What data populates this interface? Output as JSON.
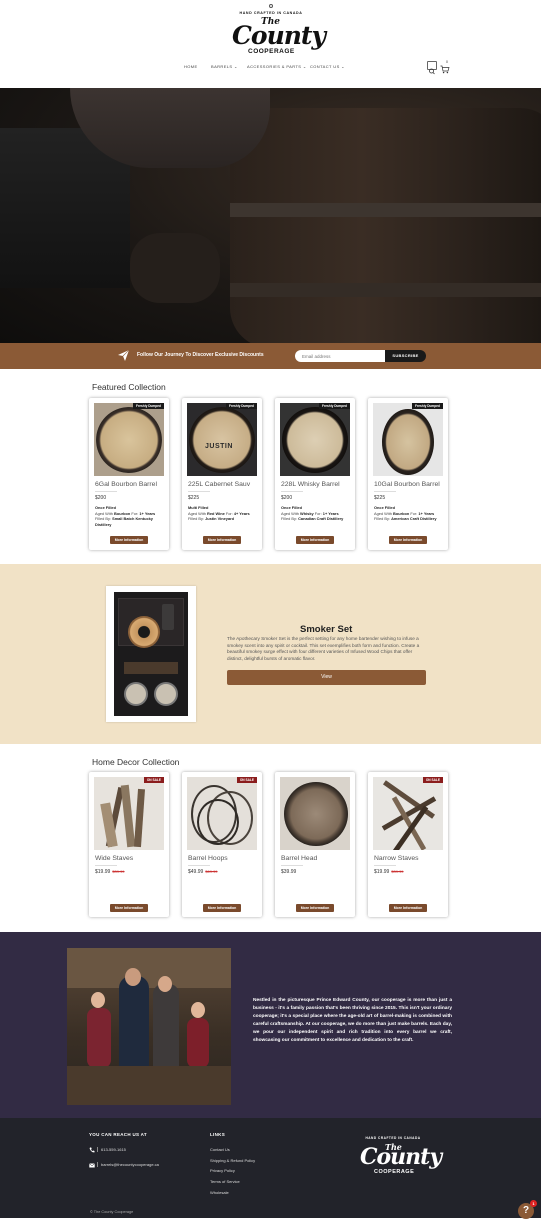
{
  "header": {
    "logo_arc": "HAND CRAFTED IN CANADA",
    "logo_the": "The",
    "logo_county": "County",
    "logo_cooperage": "COOPERAGE",
    "nav": [
      {
        "label": "HOME"
      },
      {
        "label": "BARRELS ⌄"
      },
      {
        "label": "ACCESSORIES & PARTS ⌄"
      },
      {
        "label": "CONTACT US ⌄"
      }
    ],
    "icons": [
      "search-icon",
      "cart-icon"
    ],
    "cart_count": "0"
  },
  "signup": {
    "text": "Follow Our Journey To Discover Exclusive Discounts",
    "placeholder": "Email address",
    "button": "SUBSCRIBE"
  },
  "featured": {
    "title": "Featured Collection",
    "items": [
      {
        "tag": "Freshly Dumped",
        "name": "6Gal Bourbon Barrel",
        "price": "$200",
        "fill": "Once Filled",
        "aged_label": "Aged With",
        "aged_spirit": "Bourbon",
        "for_label": "For:",
        "years": "1+ Years",
        "filled_label": "Filled By:",
        "filled_by": "Small Batch Kentucky Distillery",
        "button": "More Information"
      },
      {
        "tag": "Freshly Dumped",
        "name": "225L Cabernet Sauv",
        "price": "$225",
        "fill": "Multi Filled",
        "aged_label": "Aged With",
        "aged_spirit": "Red Wine",
        "for_label": "For:",
        "years": "4+ Years",
        "filled_label": "Filled By:",
        "filled_by": "Justin Vineyard",
        "button": "More Information"
      },
      {
        "tag": "Freshly Dumped",
        "name": "228L Whisky Barrel",
        "price": "$200",
        "fill": "Once Filled",
        "aged_label": "Aged With",
        "aged_spirit": "Whisky",
        "for_label": "For:",
        "years": "1+ Years",
        "filled_label": "Filled By:",
        "filled_by": "Canadian Craft Distillery",
        "button": "More Information"
      },
      {
        "tag": "Freshly Dumped",
        "name": "10Gal Bourbon Barrel",
        "price": "$225",
        "fill": "Once Filled",
        "aged_label": "Aged With",
        "aged_spirit": "Bourbon",
        "for_label": "For:",
        "years": "1+ Years",
        "filled_label": "Filled By:",
        "filled_by": "American Craft Distillery",
        "button": "More Information"
      }
    ]
  },
  "smoker": {
    "title": "Smoker Set",
    "description": "The Apothecary Smoker Set is the perfect setting for any home bartender wishing to infuse a smokey scent into any spirit or cocktail. This set exemplifies both form and function. Create a beautiful smokey surge effect with four different varieties of Infused Wood Chips that offer distinct, delightful bursts of aromatic flavor.",
    "button": "View"
  },
  "decor": {
    "title": "Home Decor Collection",
    "items": [
      {
        "tag": "ON SALE",
        "name": "Wide Staves",
        "price": "$19.99",
        "old_price": "$39.99",
        "button": "More Information"
      },
      {
        "tag": "ON SALE",
        "name": "Barrel Hoops",
        "price": "$49.99",
        "old_price": "$69.99",
        "button": "More Information"
      },
      {
        "tag": "",
        "name": "Barrel Head",
        "price": "$39.99",
        "old_price": "",
        "button": "More Information"
      },
      {
        "tag": "ON SALE",
        "name": "Narrow Staves",
        "price": "$19.99",
        "old_price": "$39.99",
        "button": "More Information"
      }
    ]
  },
  "about": {
    "text": "Nestled in the picturesque Prince Edward County, our cooperage is more than just a business - it's a family passion that's been thriving since 2015. This isn't your ordinary cooperage; it's a special place where the age-old art of barrel-making is combined with careful craftsmanship. At our cooperage, we do more than just make barrels. Each day, we pour our independent spirit and rich tradition into every barrel we craft, showcasing our commitment to excellence and dedication to the craft."
  },
  "footer": {
    "reach_title": "YOU CAN REACH US AT",
    "phone": "613-559-1615",
    "email": "barrels@thecountycooperage.ca",
    "links_title": "LINKS",
    "links": [
      "Contact Us",
      "Shipping & Refund Policy",
      "Privacy Policy",
      "Terms of Service",
      "Wholesale"
    ],
    "copyright": "© The County Cooperage"
  },
  "help_badge": "1",
  "help_label": "?",
  "colors": {
    "brand_brown": "#8b5a36",
    "about_bg": "#322b44",
    "footer_bg": "#22232a",
    "smoker_bg": "#f1e2c6"
  }
}
